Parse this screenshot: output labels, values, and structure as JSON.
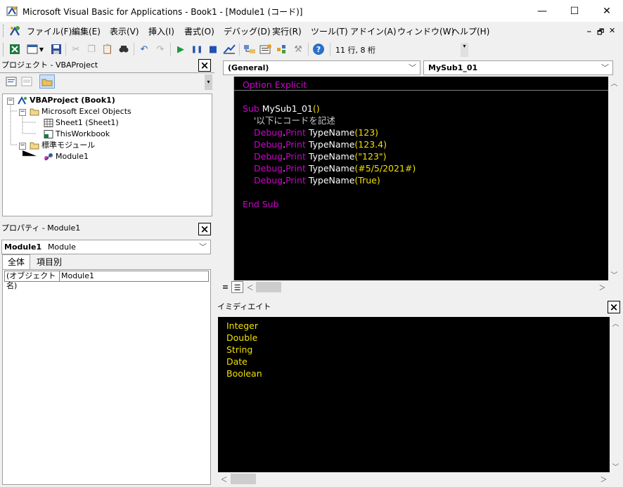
{
  "window": {
    "title": "Microsoft Visual Basic for Applications - Book1 - [Module1 (コード)]",
    "minimize": "—",
    "maximize": "☐",
    "close": "✕"
  },
  "menu": {
    "items": [
      "ファイル(F)",
      "編集(E)",
      "表示(V)",
      "挿入(I)",
      "書式(O)",
      "デバッグ(D)",
      "実行(R)",
      "ツール(T)",
      "アドイン(A)",
      "ウィンドウ(W)",
      "ヘルプ(H)"
    ],
    "mdi_minimize": "_",
    "mdi_restore": "🗗",
    "mdi_close": "✕"
  },
  "toolbar": {
    "cursor_position": "11 行, 8 桁",
    "icons": [
      "excel-icon",
      "insert-userform-icon",
      "dropdown-icon",
      "save-icon",
      "cut-icon",
      "copy-icon",
      "paste-icon",
      "find-icon",
      "undo-icon",
      "redo-icon",
      "run-icon",
      "break-icon",
      "reset-icon",
      "design-mode-icon",
      "project-explorer-icon",
      "properties-icon",
      "object-browser-icon",
      "toolbox-icon",
      "help-icon"
    ]
  },
  "project_pane": {
    "title": "プロジェクト - VBAProject",
    "tree": {
      "root": "VBAProject (Book1)",
      "folder_objects": "Microsoft Excel Objects",
      "sheet1": "Sheet1 (Sheet1)",
      "thisworkbook": "ThisWorkbook",
      "folder_modules": "標準モジュール",
      "module1": "Module1"
    }
  },
  "properties_pane": {
    "title": "プロパティ - Module1",
    "object_name": "Module1",
    "object_type": "Module",
    "tab_all": "全体",
    "tab_category": "項目別",
    "prop_name": "(オブジェクト名)",
    "prop_value": "Module1"
  },
  "code_pane": {
    "object_combo": "(General)",
    "proc_combo": "MySub1_01",
    "declaration": "Option Explicit"
  },
  "code": {
    "l1_kw": "Sub",
    "l1_name": " MySub1_01",
    "l1_paren": "()",
    "l2": "    '以下にコードを記述",
    "l3_a": "Debug",
    "l3_b": ".",
    "l3_c": "Print",
    "l3_d": " TypeName",
    "l3_e": "(123)",
    "l4_a": "Debug",
    "l4_b": ".",
    "l4_c": "Print",
    "l4_d": " TypeName",
    "l4_e": "(123.4)",
    "l5_a": "Debug",
    "l5_b": ".",
    "l5_c": "Print",
    "l5_d": " TypeName",
    "l5_e": "(\"123\")",
    "l6_a": "Debug",
    "l6_b": ".",
    "l6_c": "Print",
    "l6_d": " TypeName",
    "l6_e": "(#5/5/2021#)",
    "l7_a": "Debug",
    "l7_b": ".",
    "l7_c": "Print",
    "l7_d": " TypeName",
    "l7_e": "(True)",
    "end_sub": "End Sub"
  },
  "immediate_pane": {
    "title": "イミディエイト",
    "lines": [
      "Integer",
      "Double",
      "String",
      "Date",
      "Boolean"
    ]
  },
  "colors": {
    "keyword": "#d000d0",
    "identifier": "#ffffff",
    "literal": "#f0e000",
    "code_bg": "#000000"
  }
}
